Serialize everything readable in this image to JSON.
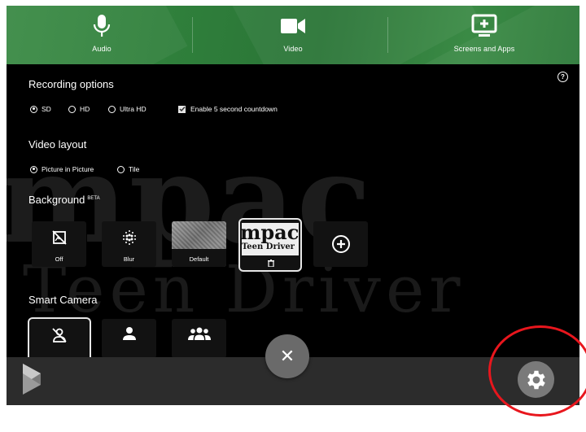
{
  "topbar": {
    "tabs": [
      {
        "label": "Audio",
        "icon": "microphone-icon"
      },
      {
        "label": "Video",
        "icon": "video-camera-icon"
      },
      {
        "label": "Screens and Apps",
        "icon": "screen-add-icon"
      }
    ],
    "color": "#2f7d3c"
  },
  "recording": {
    "title": "Recording options",
    "quality": [
      {
        "label": "SD",
        "selected": true
      },
      {
        "label": "HD",
        "selected": false
      },
      {
        "label": "Ultra HD",
        "selected": false
      }
    ],
    "countdown_label": "Enable 5 second countdown",
    "countdown_checked": true
  },
  "layout": {
    "title": "Video layout",
    "options": [
      {
        "label": "Picture in Picture",
        "selected": true
      },
      {
        "label": "Tile",
        "selected": false
      }
    ]
  },
  "background": {
    "title": "Background",
    "badge": "BETA",
    "tiles": [
      {
        "label": "Off",
        "icon": "no-image-icon"
      },
      {
        "label": "Blur",
        "icon": "blur-icon"
      },
      {
        "label": "Default",
        "icon": "default-background-thumbnail"
      },
      {
        "label": "",
        "icon": "custom-logo-thumbnail",
        "thumb_line1": "mpac",
        "thumb_line2": "Teen Driver",
        "selected": true
      },
      {
        "label": "",
        "icon": "add-circle-icon"
      }
    ]
  },
  "smart_camera": {
    "title": "Smart Camera",
    "options": [
      {
        "icon": "person-off-icon",
        "selected": true
      },
      {
        "icon": "person-icon",
        "selected": false
      },
      {
        "icon": "group-icon",
        "selected": false
      }
    ]
  },
  "backdrop": {
    "line1": "mpac",
    "line2": "Teen  Driver"
  },
  "bottombar": {
    "close_symbol": "✕",
    "help_symbol": "?"
  }
}
